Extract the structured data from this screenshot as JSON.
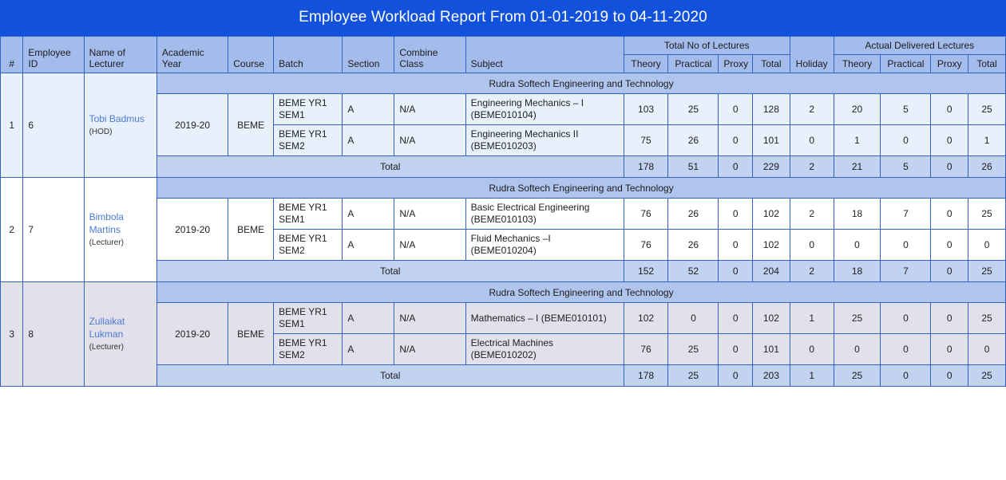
{
  "report": {
    "title": "Employee Workload Report From 01-01-2019 to 04-11-2020",
    "colors": {
      "title_bar": "#1251DC",
      "header_bg": "#A3BCEC",
      "institution_bg": "#AFC5EE",
      "total_row_bg": "#C2D2F1",
      "border": "#2F62C4",
      "link_text": "#4A7AD6"
    }
  },
  "header": {
    "index": "#",
    "employee_id": "Employee ID",
    "name_of_lecturer": "Name of Lecturer",
    "academic_year": "Academic Year",
    "course": "Course",
    "batch": "Batch",
    "section": "Section",
    "combine_class": "Combine Class",
    "subject": "Subject",
    "total_no_of_lectures": "Total No of Lectures",
    "actual_delivered_lectures": "Actual Delivered Lectures",
    "holiday": "Holiday",
    "theory": "Theory",
    "practical": "Practical",
    "proxy": "Proxy",
    "total": "Total",
    "total_label": "Total"
  },
  "groups": [
    {
      "index": "1",
      "employee_id": "6",
      "lecturer_name": "Tobi Badmus",
      "lecturer_role": "(HOD)",
      "institution": "Rudra Softech Engineering and Technology",
      "academic_year": "2019-20",
      "course": "BEME",
      "rows": [
        {
          "batch_line1": "BEME YR1",
          "batch_line2": "SEM1",
          "section": "A",
          "combine_class": "N/A",
          "subject_line1": "Engineering Mechanics – I",
          "subject_line2": "(BEME010104)",
          "total_theory": "103",
          "total_practical": "25",
          "total_proxy": "0",
          "total_total": "128",
          "holiday": "2",
          "actual_theory": "20",
          "actual_practical": "5",
          "actual_proxy": "0",
          "actual_total": "25"
        },
        {
          "batch_line1": "BEME YR1",
          "batch_line2": "SEM2",
          "section": "A",
          "combine_class": "N/A",
          "subject_line1": "Engineering Mechanics II",
          "subject_line2": "(BEME010203)",
          "total_theory": "75",
          "total_practical": "26",
          "total_proxy": "0",
          "total_total": "101",
          "holiday": "0",
          "actual_theory": "1",
          "actual_practical": "0",
          "actual_proxy": "0",
          "actual_total": "1"
        }
      ],
      "totals": {
        "total_theory": "178",
        "total_practical": "51",
        "total_proxy": "0",
        "total_total": "229",
        "holiday": "2",
        "actual_theory": "21",
        "actual_practical": "5",
        "actual_proxy": "0",
        "actual_total": "26"
      }
    },
    {
      "index": "2",
      "employee_id": "7",
      "lecturer_name": "Bimbola Martins",
      "lecturer_role": "(Lecturer)",
      "institution": "Rudra Softech Engineering and Technology",
      "academic_year": "2019-20",
      "course": "BEME",
      "rows": [
        {
          "batch_line1": "BEME YR1",
          "batch_line2": "SEM1",
          "section": "A",
          "combine_class": "N/A",
          "subject_line1": "Basic Electrical Engineering",
          "subject_line2": "(BEME010103)",
          "total_theory": "76",
          "total_practical": "26",
          "total_proxy": "0",
          "total_total": "102",
          "holiday": "2",
          "actual_theory": "18",
          "actual_practical": "7",
          "actual_proxy": "0",
          "actual_total": "25"
        },
        {
          "batch_line1": "BEME YR1",
          "batch_line2": "SEM2",
          "section": "A",
          "combine_class": "N/A",
          "subject_line1": "Fluid Mechanics –I (BEME010204)",
          "subject_line2": "",
          "total_theory": "76",
          "total_practical": "26",
          "total_proxy": "0",
          "total_total": "102",
          "holiday": "0",
          "actual_theory": "0",
          "actual_practical": "0",
          "actual_proxy": "0",
          "actual_total": "0"
        }
      ],
      "totals": {
        "total_theory": "152",
        "total_practical": "52",
        "total_proxy": "0",
        "total_total": "204",
        "holiday": "2",
        "actual_theory": "18",
        "actual_practical": "7",
        "actual_proxy": "0",
        "actual_total": "25"
      }
    },
    {
      "index": "3",
      "employee_id": "8",
      "lecturer_name": "Zullaikat Lukman",
      "lecturer_role": "(Lecturer)",
      "institution": "Rudra Softech Engineering and Technology",
      "academic_year": "2019-20",
      "course": "BEME",
      "rows": [
        {
          "batch_line1": "BEME YR1",
          "batch_line2": "SEM1",
          "section": "A",
          "combine_class": "N/A",
          "subject_line1": "Mathematics – I (BEME010101)",
          "subject_line2": "",
          "total_theory": "102",
          "total_practical": "0",
          "total_proxy": "0",
          "total_total": "102",
          "holiday": "1",
          "actual_theory": "25",
          "actual_practical": "0",
          "actual_proxy": "0",
          "actual_total": "25"
        },
        {
          "batch_line1": "BEME YR1",
          "batch_line2": "SEM2",
          "section": "A",
          "combine_class": "N/A",
          "subject_line1": "Electrical Machines (BEME010202)",
          "subject_line2": "",
          "total_theory": "76",
          "total_practical": "25",
          "total_proxy": "0",
          "total_total": "101",
          "holiday": "0",
          "actual_theory": "0",
          "actual_practical": "0",
          "actual_proxy": "0",
          "actual_total": "0"
        }
      ],
      "totals": {
        "total_theory": "178",
        "total_practical": "25",
        "total_proxy": "0",
        "total_total": "203",
        "holiday": "1",
        "actual_theory": "25",
        "actual_practical": "0",
        "actual_proxy": "0",
        "actual_total": "25"
      }
    }
  ]
}
